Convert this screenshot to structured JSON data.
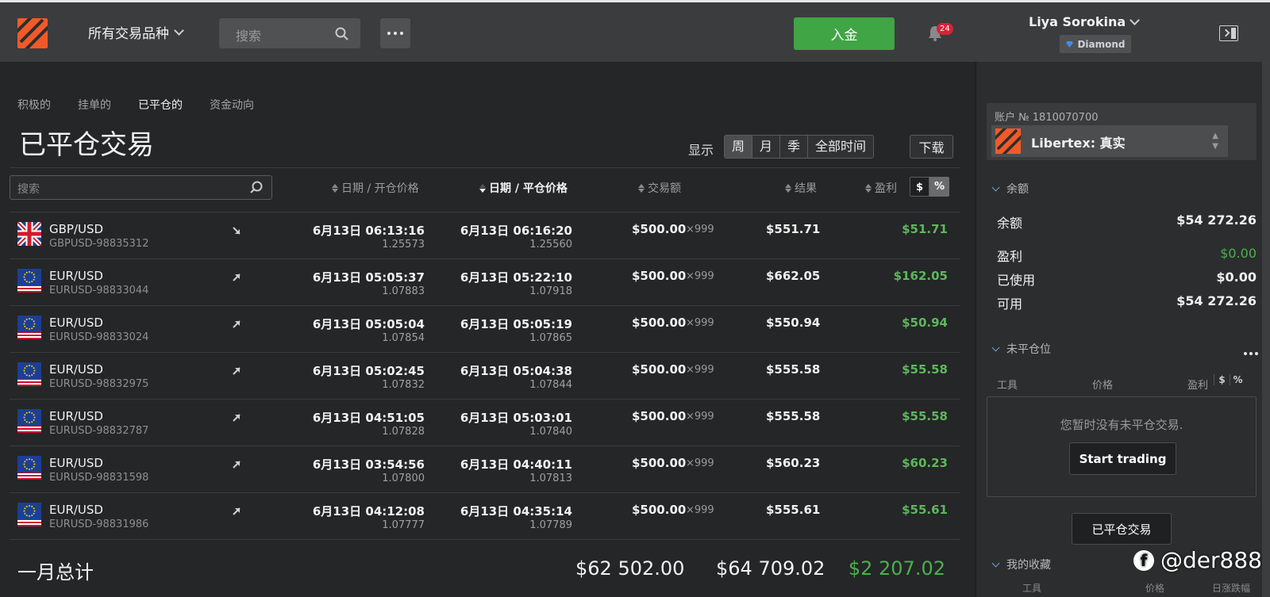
{
  "topbar": {
    "instruments_label": "所有交易品种",
    "search_placeholder": "搜索",
    "deposit_label": "入金",
    "notifications_count": "24",
    "user_name": "Liya Sorokina",
    "user_tier": "Diamond"
  },
  "main": {
    "tabs": [
      {
        "label": "积极的",
        "active": false
      },
      {
        "label": "挂单的",
        "active": false
      },
      {
        "label": "已平仓的",
        "active": true
      },
      {
        "label": "资金动向",
        "active": false
      }
    ],
    "title": "已平仓交易",
    "show_label": "显示",
    "periods": [
      {
        "label": "周",
        "active": true
      },
      {
        "label": "月",
        "active": false
      },
      {
        "label": "季",
        "active": false
      },
      {
        "label": "全部时间",
        "active": false
      }
    ],
    "download_label": "下载",
    "table_search_placeholder": "搜索",
    "columns": {
      "open": "日期 / 开仓价格",
      "close": "日期 / 平仓价格",
      "amount": "交易额",
      "result": "结果",
      "pnl": "盈利"
    },
    "unit_toggle": {
      "dollar": "$",
      "percent": "%"
    },
    "trades": [
      {
        "pair": "GBP/USD",
        "id": "GBPUSD-98835312",
        "flag": "gb-flag",
        "direction": "down",
        "open_dt": "6月13日 06:13:16",
        "open_px": "1.25573",
        "close_dt": "6月13日 06:16:20",
        "close_px": "1.25560",
        "amount": "$500.00",
        "mult": "×999",
        "result": "$551.71",
        "pnl": "$51.71"
      },
      {
        "pair": "EUR/USD",
        "id": "EURUSD-98833044",
        "flag": "eu-flag",
        "direction": "up",
        "open_dt": "6月13日 05:05:37",
        "open_px": "1.07883",
        "close_dt": "6月13日 05:22:10",
        "close_px": "1.07918",
        "amount": "$500.00",
        "mult": "×999",
        "result": "$662.05",
        "pnl": "$162.05"
      },
      {
        "pair": "EUR/USD",
        "id": "EURUSD-98833024",
        "flag": "eu-flag",
        "direction": "up",
        "open_dt": "6月13日 05:05:04",
        "open_px": "1.07854",
        "close_dt": "6月13日 05:05:19",
        "close_px": "1.07865",
        "amount": "$500.00",
        "mult": "×999",
        "result": "$550.94",
        "pnl": "$50.94"
      },
      {
        "pair": "EUR/USD",
        "id": "EURUSD-98832975",
        "flag": "eu-flag",
        "direction": "up",
        "open_dt": "6月13日 05:02:45",
        "open_px": "1.07832",
        "close_dt": "6月13日 05:04:38",
        "close_px": "1.07844",
        "amount": "$500.00",
        "mult": "×999",
        "result": "$555.58",
        "pnl": "$55.58"
      },
      {
        "pair": "EUR/USD",
        "id": "EURUSD-98832787",
        "flag": "eu-flag",
        "direction": "up",
        "open_dt": "6月13日 04:51:05",
        "open_px": "1.07828",
        "close_dt": "6月13日 05:03:01",
        "close_px": "1.07840",
        "amount": "$500.00",
        "mult": "×999",
        "result": "$555.58",
        "pnl": "$55.58"
      },
      {
        "pair": "EUR/USD",
        "id": "EURUSD-98831598",
        "flag": "eu-flag",
        "direction": "up",
        "open_dt": "6月13日 03:54:56",
        "open_px": "1.07800",
        "close_dt": "6月13日 04:40:11",
        "close_px": "1.07813",
        "amount": "$500.00",
        "mult": "×999",
        "result": "$560.23",
        "pnl": "$60.23"
      },
      {
        "pair": "EUR/USD",
        "id": "EURUSD-98831986",
        "flag": "eu-flag",
        "direction": "up",
        "open_dt": "6月13日 04:12:08",
        "open_px": "1.07777",
        "close_dt": "6月13日 04:35:14",
        "close_px": "1.07789",
        "amount": "$500.00",
        "mult": "×999",
        "result": "$555.61",
        "pnl": "$55.61"
      }
    ],
    "totals": {
      "label": "一月总计",
      "amount": "$62 502.00",
      "result": "$64 709.02",
      "pnl": "$2 207.02"
    }
  },
  "sidebar": {
    "account_no": "账户 № 1810070700",
    "account_name": "Libertex: 真实",
    "balance_section": "余额",
    "balance": [
      {
        "label": "余额",
        "value": "$54 272.26"
      },
      {
        "label": "盈利",
        "value": "$0.00"
      },
      {
        "label": "已使用",
        "value": "$0.00"
      },
      {
        "label": "可用",
        "value": "$54 272.26"
      }
    ],
    "open_positions_section": "未平仓位",
    "pos_cols": {
      "instrument": "工具",
      "price": "价格",
      "profit": "盈利"
    },
    "mini_toggle": {
      "dollar": "$",
      "percent": "%"
    },
    "empty_text": "您暂时没有未平仓交易.",
    "start_trading": "Start trading",
    "closed_trades_btn": "已平仓交易",
    "favorites_section": "我的收藏",
    "fav_cols": {
      "instrument": "工具",
      "price": "价格",
      "change": "日涨跌幅"
    }
  },
  "watermark": "@der888",
  "colors": {
    "accent_green": "#40a544",
    "profit_green": "#5cb85c",
    "brand_orange": "#f05a28"
  }
}
